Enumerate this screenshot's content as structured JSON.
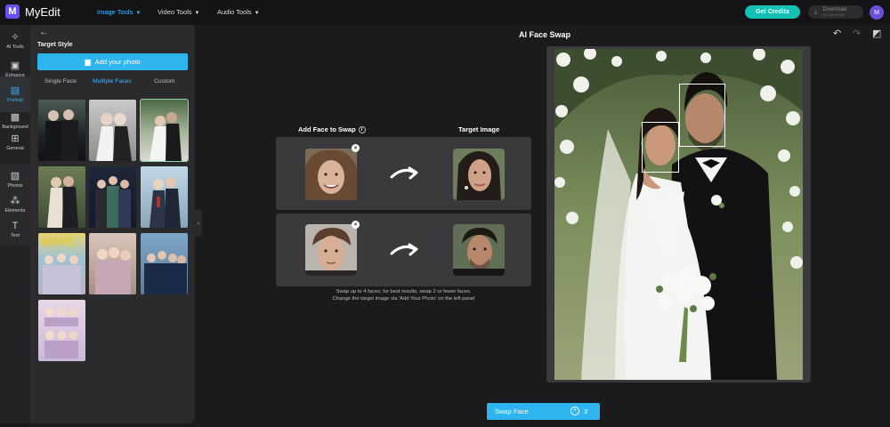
{
  "app": {
    "name": "MyEdit",
    "logo_letter": "M"
  },
  "nav": [
    {
      "label": "Image Tools",
      "active": true
    },
    {
      "label": "Video Tools",
      "active": false
    },
    {
      "label": "Audio Tools",
      "active": false
    }
  ],
  "header": {
    "credits_label": "Get Credits",
    "download_label": "Download",
    "download_sub": "No Watermark",
    "avatar_initial": "M"
  },
  "rail": [
    {
      "label": "AI Tools",
      "icon": "magic-wand-icon"
    },
    {
      "label": "Enhance",
      "icon": "image-enhance-icon"
    },
    {
      "label": "Portrait",
      "icon": "portrait-icon"
    },
    {
      "label": "Background",
      "icon": "background-icon"
    },
    {
      "label": "General",
      "icon": "grid-icon"
    },
    {
      "label": "Photos",
      "icon": "photo-icon"
    },
    {
      "label": "Elements",
      "icon": "elements-icon"
    },
    {
      "label": "Text",
      "icon": "text-icon"
    }
  ],
  "panel": {
    "title": "Target Style",
    "add_photo_label": "Add your photo",
    "tabs": [
      {
        "label": "Single Face",
        "active": false
      },
      {
        "label": "Multiple Faces",
        "active": true
      },
      {
        "label": "Custom",
        "active": false
      }
    ],
    "templates_count": 10
  },
  "main": {
    "title": "AI Face Swap",
    "col_left": "Add Face to Swap",
    "col_right": "Target Image",
    "note_line1": "Swap up to 4 faces; for best results, swap 2 or fewer faces.",
    "note_line2": "Change the target image via 'Add Your Photo' on the left panel",
    "swap_label": "Swap Face",
    "swap_cost": "3"
  },
  "colors": {
    "accent": "#2eb5ef",
    "credits": "#14c2b3",
    "highlight": "#f2c531"
  }
}
